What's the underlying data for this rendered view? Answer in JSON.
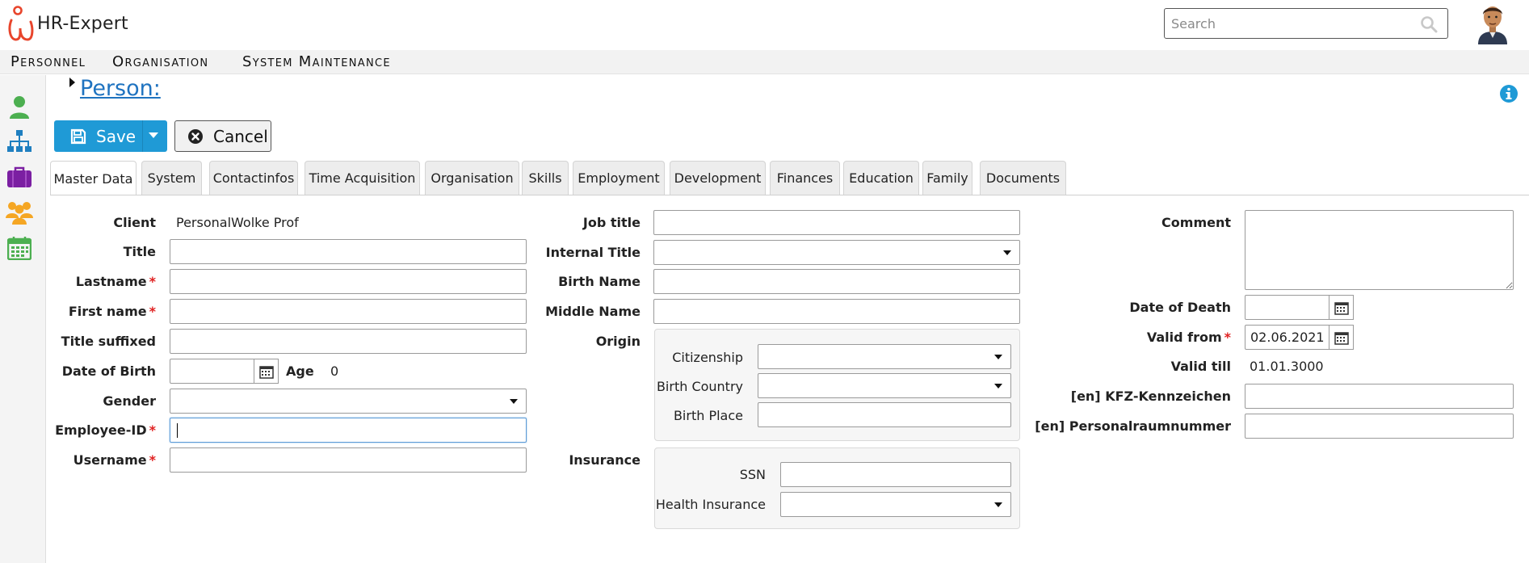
{
  "app": {
    "name": "HR-Expert",
    "search_placeholder": "Search",
    "colors": {
      "accent": "#1f9ad6",
      "link": "#1f73c0",
      "logo": "#e8452c",
      "required": "#e02020"
    }
  },
  "menu": [
    "Personnel",
    "Organisation",
    "System Maintenance"
  ],
  "sidebar": [
    {
      "icon": "person-icon",
      "color": "#4caf50"
    },
    {
      "icon": "org-chart-icon",
      "color": "#1f7fc0"
    },
    {
      "icon": "briefcase-icon",
      "color": "#7b1fa2"
    },
    {
      "icon": "group-icon",
      "color": "#f5a623"
    },
    {
      "icon": "calendar-icon",
      "color": "#4caf50"
    }
  ],
  "breadcrumb": "Person:",
  "toolbar": {
    "save_label": "Save",
    "cancel_label": "Cancel"
  },
  "tabs": [
    "Master Data",
    "System",
    "Contactinfos",
    "Time Acquisition",
    "Organisation",
    "Skills",
    "Employment",
    "Development",
    "Finances",
    "Education",
    "Family",
    "Documents"
  ],
  "active_tab": "Master Data",
  "form": {
    "col1": {
      "client_label": "Client",
      "client_value": "PersonalWolke Prof",
      "title_label": "Title",
      "lastname_label": "Lastname",
      "firstname_label": "First name",
      "title_suffixed_label": "Title suffixed",
      "dob_label": "Date of Birth",
      "age_label": "Age",
      "age_value": "0",
      "gender_label": "Gender",
      "employee_id_label": "Employee-ID",
      "username_label": "Username",
      "required_marker": "*"
    },
    "col2": {
      "job_title_label": "Job title",
      "internal_title_label": "Internal Title",
      "birth_name_label": "Birth Name",
      "middle_name_label": "Middle Name",
      "origin_label": "Origin",
      "citizenship_label": "Citizenship",
      "birth_country_label": "Birth Country",
      "birth_place_label": "Birth Place",
      "insurance_label": "Insurance",
      "ssn_label": "SSN",
      "health_insurance_label": "Health Insurance"
    },
    "col3": {
      "comment_label": "Comment",
      "date_of_death_label": "Date of Death",
      "valid_from_label": "Valid from",
      "valid_from_value": "02.06.2021",
      "valid_till_label": "Valid till",
      "valid_till_value": "01.01.3000",
      "kfz_label": "[en] KFZ-Kennzeichen",
      "raum_label": "[en] Personalraumnummer"
    }
  }
}
